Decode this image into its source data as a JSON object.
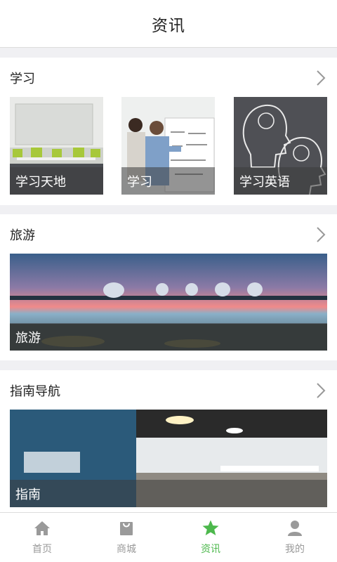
{
  "header": {
    "title": "资讯"
  },
  "sections": [
    {
      "title": "学习",
      "cards": [
        {
          "caption": "学习天地"
        },
        {
          "caption": "学习"
        },
        {
          "caption": "学习英语"
        }
      ]
    },
    {
      "title": "旅游",
      "cards": [
        {
          "caption": "旅游"
        }
      ]
    },
    {
      "title": "指南导航",
      "cards": [
        {
          "caption": "指南"
        }
      ]
    }
  ],
  "tabbar": {
    "items": [
      {
        "label": "首页",
        "icon": "home-icon"
      },
      {
        "label": "商城",
        "icon": "bag-icon"
      },
      {
        "label": "资讯",
        "icon": "star-icon",
        "active": true
      },
      {
        "label": "我的",
        "icon": "user-icon"
      }
    ]
  },
  "colors": {
    "accent": "#4cb84c",
    "inactive": "#9a9a9a"
  }
}
